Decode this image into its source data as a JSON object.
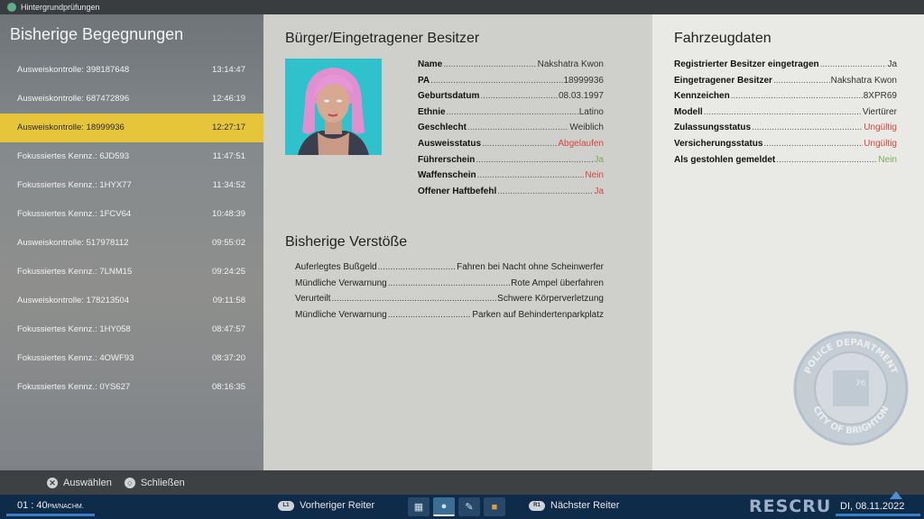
{
  "window": {
    "title": "Hintergrundprüfungen"
  },
  "encounters": {
    "title": "Bisherige Begegnungen",
    "items": [
      {
        "label": "Ausweiskontrolle: 398187648",
        "time": "13:14:47",
        "selected": false
      },
      {
        "label": "Ausweiskontrolle: 687472896",
        "time": "12:46:19",
        "selected": false
      },
      {
        "label": "Ausweiskontrolle: 18999936",
        "time": "12:27:17",
        "selected": true
      },
      {
        "label": "Fokussiertes Kennz.: 6JD593",
        "time": "11:47:51",
        "selected": false
      },
      {
        "label": "Fokussiertes Kennz.: 1HYX77",
        "time": "11:34:52",
        "selected": false
      },
      {
        "label": "Fokussiertes Kennz.: 1FCV64",
        "time": "10:48:39",
        "selected": false
      },
      {
        "label": "Ausweiskontrolle: 517978112",
        "time": "09:55:02",
        "selected": false
      },
      {
        "label": "Fokussiertes Kennz.: 7LNM15",
        "time": "09:24:25",
        "selected": false
      },
      {
        "label": "Ausweiskontrolle: 178213504",
        "time": "09:11:58",
        "selected": false
      },
      {
        "label": "Fokussiertes Kennz.: 1HY058",
        "time": "08:47:57",
        "selected": false
      },
      {
        "label": "Fokussiertes Kennz.: 4OWF93",
        "time": "08:37:20",
        "selected": false
      },
      {
        "label": "Fokussiertes Kennz.: 0YS627",
        "time": "08:16:35",
        "selected": false
      }
    ]
  },
  "owner": {
    "title": "Bürger/Eingetragener Besitzer",
    "fields": [
      {
        "label": "Name",
        "value": "Nakshatra Kwon",
        "status": "normal"
      },
      {
        "label": "PA",
        "value": "18999936",
        "status": "normal"
      },
      {
        "label": "Geburtsdatum",
        "value": "08.03.1997",
        "status": "normal"
      },
      {
        "label": "Ethnie",
        "value": "Latino",
        "status": "normal"
      },
      {
        "label": "Geschlecht",
        "value": "Weiblich",
        "status": "normal"
      },
      {
        "label": "Ausweisstatus",
        "value": "Abgelaufen",
        "status": "bad"
      },
      {
        "label": "Führerschein",
        "value": "Ja",
        "status": "good"
      },
      {
        "label": "Waffenschein",
        "value": "Nein",
        "status": "bad"
      },
      {
        "label": "Offener Haftbefehl",
        "value": "Ja",
        "status": "bad"
      }
    ]
  },
  "violations": {
    "title": "Bisherige Verstöße",
    "items": [
      {
        "type": "Auferlegtes Bußgeld",
        "desc": "Fahren bei Nacht ohne Scheinwerfer"
      },
      {
        "type": "Mündliche Verwarnung",
        "desc": "Rote Ampel überfahren"
      },
      {
        "type": "Verurteilt",
        "desc": "Schwere Körperverletzung"
      },
      {
        "type": "Mündliche Verwarnung",
        "desc": "Parken auf Behindertenparkplatz"
      }
    ]
  },
  "vehicle": {
    "title": "Fahrzeugdaten",
    "fields": [
      {
        "label": "Registrierter Besitzer eingetragen",
        "value": "Ja",
        "status": "normal"
      },
      {
        "label": "Eingetragener Besitzer",
        "value": "Nakshatra Kwon",
        "status": "normal"
      },
      {
        "label": "Kennzeichen",
        "value": "8XPR69",
        "status": "normal"
      },
      {
        "label": "Modell",
        "value": "Viertürer",
        "status": "normal"
      },
      {
        "label": "Zulassungsstatus",
        "value": "Ungültig",
        "status": "bad"
      },
      {
        "label": "Versicherungsstatus",
        "value": "Ungültig",
        "status": "bad"
      },
      {
        "label": "Als gestohlen gemeldet",
        "value": "Nein",
        "status": "good"
      }
    ],
    "seal": {
      "top": "POLICE DEPARTMENT",
      "bottom": "CITY OF BRIGHTON",
      "center": "76"
    }
  },
  "actions": {
    "select": "Auswählen",
    "close": "Schließen",
    "select_glyph": "✕",
    "close_glyph": "○"
  },
  "footer": {
    "clock": "01 : 40",
    "clock_suffix": "PM/NACHM.",
    "prev_tab": "Vorheriger Reiter",
    "next_tab": "Nächster Reiter",
    "prev_key": "L1",
    "next_key": "R1",
    "brand": "RESCRU",
    "date": "DI, 08.11.2022",
    "tab_icons": [
      "map-icon",
      "person-icon",
      "document-icon",
      "book-icon"
    ]
  },
  "colors": {
    "selected": "#e6c53a",
    "bad": "#d6453d",
    "good": "#7fa85a",
    "footer": "#0f2b4a"
  }
}
